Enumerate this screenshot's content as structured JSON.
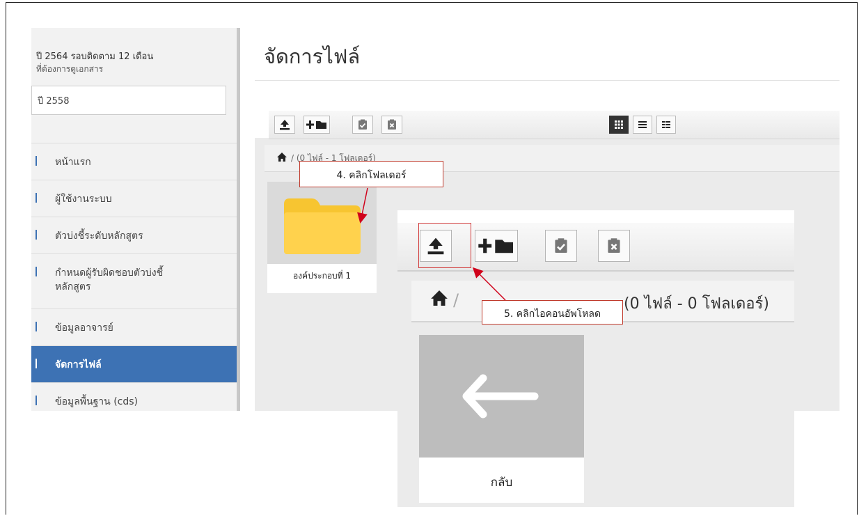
{
  "sidebar": {
    "header_line1": "ปี 2564 รอบติดตาม 12 เดือน",
    "header_line2": "ที่ต้องการดูเอกสาร",
    "year_select_value": "ปี 2558",
    "items": [
      {
        "label": "หน้าแรก"
      },
      {
        "label": "ผู้ใช้งานระบบ"
      },
      {
        "label": "ตัวบ่งชี้ระดับหลักสูตร"
      },
      {
        "label": "กำหนดผู้รับผิดชอบตัวบ่งชี้",
        "label2": "หลักสูตร"
      },
      {
        "label": "ข้อมูลอาจารย์"
      },
      {
        "label": "จัดการไฟล์"
      },
      {
        "label": "ข้อมูลพื้นฐาน (cds)"
      }
    ]
  },
  "main": {
    "title": "จัดการไฟล์",
    "breadcrumb_text": "(0 ไฟล์ - 1 โฟลเดอร์)",
    "folder_caption": "องค์ประกอบที่ 1"
  },
  "callouts": {
    "step4": "4. คลิกโฟลเดอร์",
    "step5": "5. คลิกไอคอนอัพโหลด"
  },
  "zoom": {
    "breadcrumb_text": "(0 ไฟล์ - 0 โฟลเดอร์)",
    "back_caption": "กลับ"
  },
  "icons": {
    "upload": "upload-icon",
    "new_folder": "new-folder-icon",
    "paste": "clipboard-check-icon",
    "clear": "clipboard-x-icon",
    "home": "home-icon",
    "back": "arrow-left-icon",
    "folder": "folder-icon"
  },
  "colors": {
    "accent": "#3d72b4",
    "callout_border": "#c0392b",
    "folder": "#ffd24d"
  }
}
